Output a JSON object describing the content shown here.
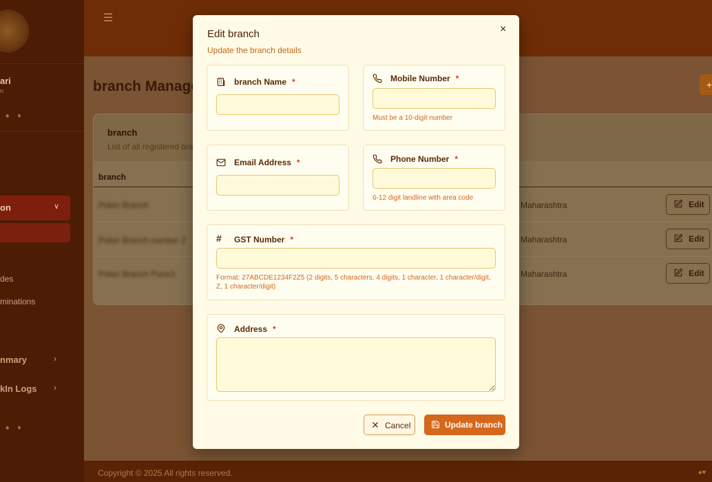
{
  "app": {
    "user_name": "ari",
    "user_role": "n",
    "page_title": "branch Manage",
    "add_label": "+",
    "footer_copyright": "Copyright © 2025 All rights reserved.",
    "sidebar": {
      "active_section": "on",
      "items": [
        {
          "label": "des"
        },
        {
          "label": "minations"
        },
        {
          "label": "nmary"
        },
        {
          "label": "kIn Logs"
        }
      ]
    },
    "table": {
      "title": "branch",
      "subtitle": "List of all registered bran",
      "column_header": "branch",
      "rows": [
        {
          "name": "Poker Branch",
          "state": "Maharashtra",
          "edit_label": "Edit"
        },
        {
          "name": "Poker Branch number 2",
          "state": "Maharashtra",
          "edit_label": "Edit"
        },
        {
          "name": "Poker Branch Pune3",
          "state": "Maharashtra",
          "edit_label": "Edit"
        }
      ]
    }
  },
  "modal": {
    "title": "Edit branch",
    "subtitle": "Update the branch details",
    "close_label": "×",
    "required_mark": "*",
    "fields": {
      "branch_name": {
        "label": "branch Name",
        "value": "",
        "icon": "building-icon"
      },
      "mobile_number": {
        "label": "Mobile Number",
        "value": "",
        "hint": "Must be a 10-digit number",
        "icon": "phone-icon"
      },
      "email_address": {
        "label": "Email Address",
        "value": "",
        "icon": "mail-icon"
      },
      "phone_number": {
        "label": "Phone Number",
        "value": "",
        "hint": "6-12 digit landline with area code",
        "icon": "phone-icon"
      },
      "gst_number": {
        "label": "GST Number",
        "value": "",
        "hint": "Format: 27ABCDE1234F2Z5 (2 digits, 5 characters, 4 digits, 1 character, 1 character/digit, Z, 1 character/digit)",
        "icon": "hash-icon"
      },
      "address": {
        "label": "Address",
        "value": "",
        "icon": "map-pin-icon"
      }
    },
    "cancel_label": "Cancel",
    "update_label": "Update branch"
  },
  "colors": {
    "accent": "#d5681c",
    "modal_bg": "#fffbe6",
    "required": "#d83a1e",
    "hint": "#d0681a"
  }
}
